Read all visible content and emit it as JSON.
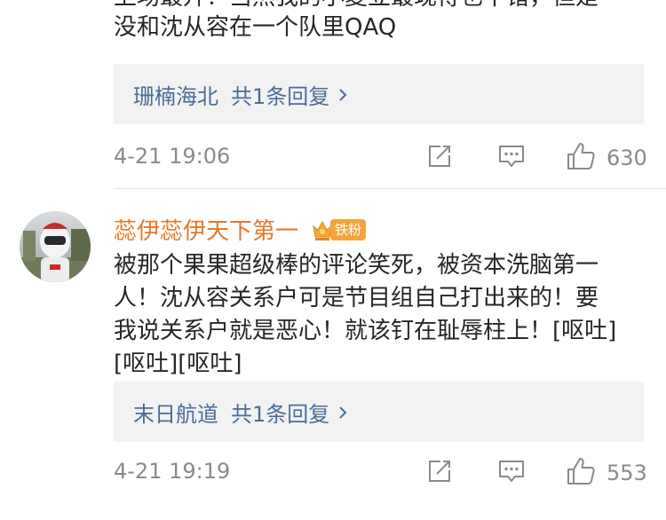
{
  "comments": [
    {
      "text_lines": [
        "上场最升！当然我的小夏立最现得也不错，但是",
        "没和沈从容在一个队里QAQ"
      ],
      "reply": {
        "user": "珊楠海北",
        "count": "共1条回复"
      },
      "time": "4-21 19:06",
      "likes": "630",
      "icons": {
        "share": "share-icon",
        "comment": "comment-icon",
        "like": "thumbs-up-icon",
        "chevron": "chevron-right-icon"
      }
    },
    {
      "user": "蕊伊蕊伊天下第一",
      "badge": "铁粉",
      "text_lines": [
        "被那个果果超级棒的评论笑死，被资本洗脑第一",
        "人！沈从容关系户可是节目组自己打出来的！要",
        "我说关系户就是恶心！就该钉在耻辱柱上！[呕吐]",
        "[呕吐][呕吐]"
      ],
      "reply": {
        "user": "末日航道",
        "count": "共1条回复"
      },
      "time": "4-21 19:19",
      "likes": "553"
    }
  ],
  "colors": {
    "username": "#e3792a",
    "reply_link": "#4a6e97",
    "meta": "#8a8a8a",
    "reply_bg": "#f2f2f2",
    "badge": "#f5a53b"
  }
}
